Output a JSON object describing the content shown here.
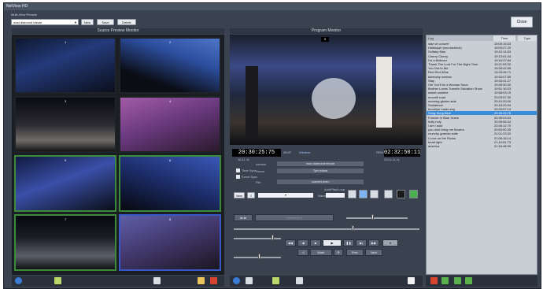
{
  "window": {
    "title": "NetView HD"
  },
  "toolbar": {
    "preset_label": "Multi-View Presets",
    "preset_value": "mad diamond tribute",
    "new_label": "New",
    "save_label": "Save",
    "delete_label": "Delete",
    "close_label": "Close"
  },
  "source_preview": {
    "title": "Source Preview Monitor",
    "tile_numbers": [
      "1",
      "2",
      "3",
      "4",
      "5",
      "6",
      "7",
      "8"
    ]
  },
  "program": {
    "title": "Program Monitor",
    "badge": "9",
    "time_current": "20:30:25:75",
    "time_rate": "29.97",
    "time_remaining_label": "REM",
    "time_remaining": "02:32:50:11",
    "info_left_date": "16.11.11",
    "info_right_date": "2014-11-11",
    "event_label": "concert",
    "event_value": "mad diamond tribute",
    "venue_label": "Venue",
    "venue_value": "7pm show",
    "file_label": "File",
    "file_value": "concert.wmv",
    "check1_label": "Time Sync",
    "check2_label": "Event Sync",
    "new_label": "New",
    "name_label": "Name",
    "autoplay_label": "AutoPlay/Loop",
    "prev_label": "Prev",
    "next_label": "Next",
    "mark_label": "Mark"
  },
  "log": {
    "col_log": "Log",
    "col_time": "Time",
    "col_type": "Type",
    "rows": [
      {
        "name": "start of concert",
        "time": "19:00:15.63"
      },
      {
        "name": "Hallelujah (soundcheck)",
        "time": "19:03:27.20"
      },
      {
        "name": "Solitary Man",
        "time": "19:10:14.53"
      },
      {
        "name": "Cherry Cherry",
        "time": "19:13:01.04"
      },
      {
        "name": "I'm a Believer",
        "time": "19:16:37.84"
      },
      {
        "name": "Thank The Lord For The Night Time",
        "time": "19:21:53.32"
      },
      {
        "name": "You Got to Me",
        "time": "19:26:42.65"
      },
      {
        "name": "Red Red Wine",
        "time": "19:29:46.71"
      },
      {
        "name": "kentucky woman",
        "time": "19:34:07.55"
      },
      {
        "name": "Stay",
        "time": "19:40:41.27"
      },
      {
        "name": "Girl You'll be a Woman Soon",
        "time": "19:45:30.90"
      },
      {
        "name": "Brother Loves Travelin Salvation Show",
        "time": "19:51:16.03"
      },
      {
        "name": "sweet caroline",
        "time": "19:58:03.15"
      },
      {
        "name": "moonlit road",
        "time": "20:03:57.30"
      },
      {
        "name": "morning glories side",
        "time": "20:10:33.00"
      },
      {
        "name": "Soolaimon",
        "time": "20:15:20.94"
      },
      {
        "name": "brooklyn roads seg",
        "time": "20:20:57.13"
      },
      {
        "name": "Song Sung Blue",
        "time": "20:30:25.75"
      },
      {
        "name": "Forever in Blue Jeans",
        "time": "20:35:03.53"
      },
      {
        "name": "holly holy",
        "time": "20:39:55.34"
      },
      {
        "name": "i am i said",
        "time": "20:45:12.70"
      },
      {
        "name": "you dont bring me flowers",
        "time": "20:53:00.35"
      },
      {
        "name": "crunchy granola suite",
        "time": "21:01:33.00"
      },
      {
        "name": "i,Love on the Rocks",
        "time": "21:06:16.14"
      },
      {
        "name": "heart light",
        "time": "21:10:51.73"
      },
      {
        "name": "america",
        "time": "21:16:48.59"
      }
    ],
    "selected_index": 17
  },
  "colors": {
    "accent_green": "#3c8a3c",
    "accent_blue": "#3858c8",
    "select_blue": "#3a8bd8"
  }
}
